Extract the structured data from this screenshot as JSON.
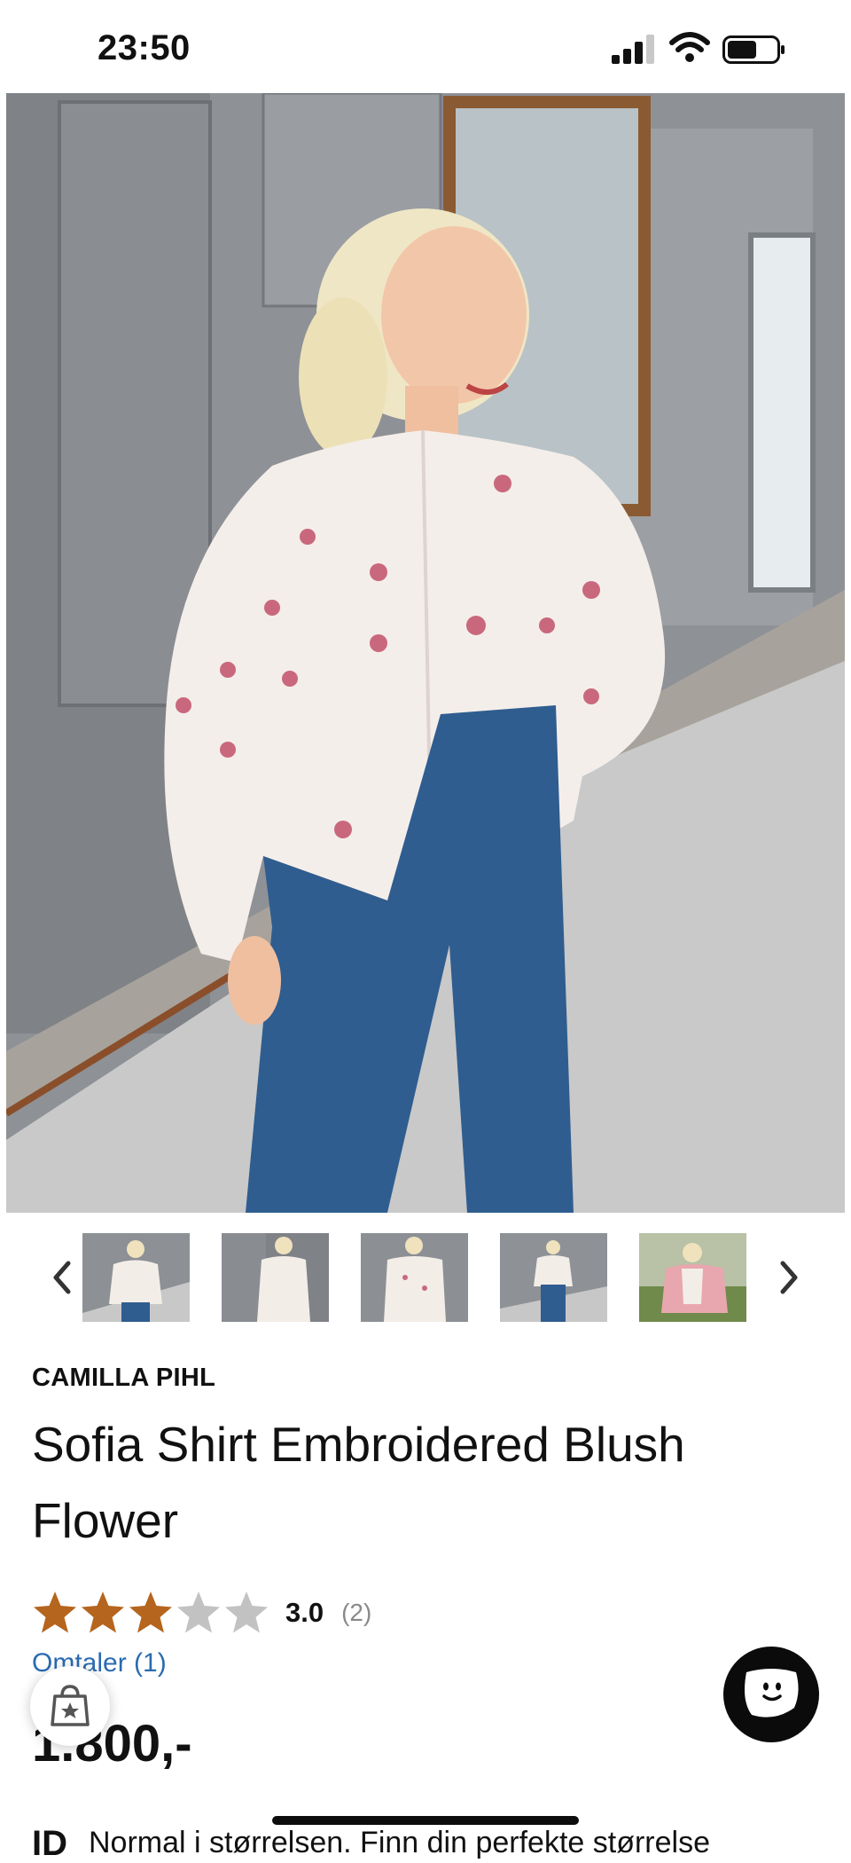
{
  "status_bar": {
    "time": "23:50",
    "signal_icon": "cellular-signal-icon",
    "wifi_icon": "wifi-icon",
    "battery_icon": "battery-icon"
  },
  "gallery": {
    "main_image": "product-photo-woman-white-embroidered-shirt",
    "thumbnails": [
      "thumbnail-front-view",
      "thumbnail-back-view",
      "thumbnail-side-view",
      "thumbnail-full-length",
      "thumbnail-outdoor-pink-cardigan"
    ],
    "prev_icon": "chevron-left-icon",
    "next_icon": "chevron-right-icon"
  },
  "product": {
    "brand": "CAMILLA PIHL",
    "title": "Sofia Shirt Embroidered Blush Flower",
    "rating": 3,
    "rating_max": 5,
    "rating_text": "3.0",
    "rating_count": "(2)",
    "reviews_link": "Omtaler (1)",
    "price": "1.800,-"
  },
  "size_hint": {
    "mark": "ID",
    "text": "Normal i størrelsen. Finn din perfekte størrelse"
  },
  "floating": {
    "shop_icon": "shopping-bag-star-icon",
    "chat_icon": "chat-face-icon"
  },
  "colors": {
    "star_filled": "#b5651d",
    "star_empty": "#c2c2c2",
    "link": "#2a6bb0",
    "price": "#111111"
  }
}
